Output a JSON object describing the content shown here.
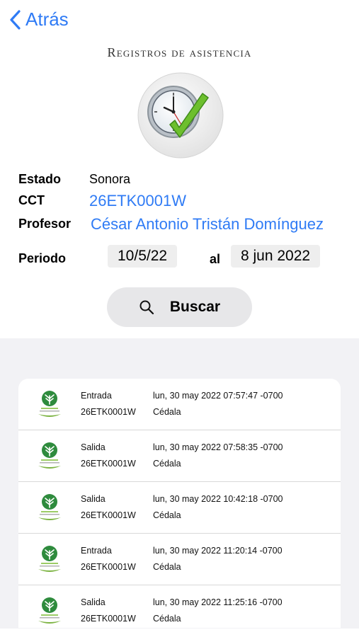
{
  "nav": {
    "back_label": "Atrás"
  },
  "page": {
    "title": "Registros de asistencia"
  },
  "info": {
    "estado_label": "Estado",
    "estado_value": "Sonora",
    "cct_label": "CCT",
    "cct_value": "26ETK0001W",
    "profesor_label": "Profesor",
    "profesor_value": "César Antonio Tristán Domínguez",
    "periodo_label": "Periodo",
    "periodo_from": "10/5/22",
    "periodo_sep": "al",
    "periodo_to": "8 jun 2022"
  },
  "search": {
    "label": "Buscar",
    "icon": "search-icon"
  },
  "records": [
    {
      "type": "Entrada",
      "code": "26ETK0001W",
      "date": "lun, 30 may 2022 07:57:47 -0700",
      "app": "Cédala"
    },
    {
      "type": "Salida",
      "code": "26ETK0001W",
      "date": "lun, 30 may 2022 07:58:35 -0700",
      "app": "Cédala"
    },
    {
      "type": "Salida",
      "code": "26ETK0001W",
      "date": "lun, 30 may 2022 10:42:18 -0700",
      "app": "Cédala"
    },
    {
      "type": "Entrada",
      "code": "26ETK0001W",
      "date": "lun, 30 may 2022 11:20:14 -0700",
      "app": "Cédala"
    },
    {
      "type": "Salida",
      "code": "26ETK0001W",
      "date": "lun, 30 may 2022 11:25:16 -0700",
      "app": "Cédala"
    }
  ],
  "colors": {
    "accent": "#2f7bf5",
    "list_bg": "#f2f2f5",
    "logo_green": "#2e8b3d"
  }
}
